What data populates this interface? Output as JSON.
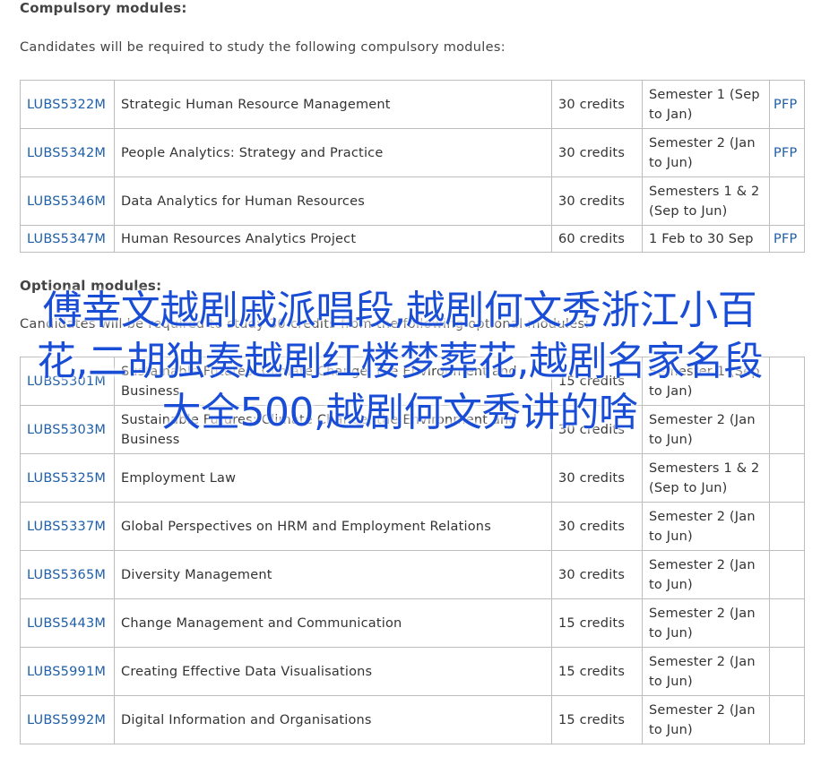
{
  "compulsory": {
    "heading": "Compulsory modules:",
    "intro": "Candidates will be required to study the following compulsory modules:",
    "rows": [
      {
        "code": "LUBS5322M",
        "title": "Strategic Human Resource Management",
        "credits": "30 credits",
        "semester": "Semester 1 (Sep to Jan)",
        "pfp": "PFP"
      },
      {
        "code": "LUBS5342M",
        "title": "People Analytics: Strategy and Practice",
        "credits": "30 credits",
        "semester": "Semester 2 (Jan to Jun)",
        "pfp": "PFP"
      },
      {
        "code": "LUBS5346M",
        "title": "Data Analytics for Human Resources",
        "credits": "30 credits",
        "semester": "Semesters 1 & 2 (Sep to Jun)",
        "pfp": ""
      },
      {
        "code": "LUBS5347M",
        "title": "Human Resources Analytics Project",
        "credits": "60 credits",
        "semester": "1 Feb to 30 Sep",
        "pfp": "PFP"
      }
    ]
  },
  "optional": {
    "heading": "Optional modules:",
    "intro": "Candidates will be required to study 30 credits from the following optional modules:",
    "rows": [
      {
        "code": "LUBS5301M",
        "title": "Sustainable Futures: Climate Change, the Environment and Business",
        "credits": "15 credits",
        "semester": "Semester 1 (Sep to Jan)",
        "pfp": ""
      },
      {
        "code": "LUBS5303M",
        "title": "Sustainable Futures: Climate Change, the Environment and Business",
        "credits": "30 credits",
        "semester": "Semester 2 (Jan to Jun)",
        "pfp": ""
      },
      {
        "code": "LUBS5325M",
        "title": "Employment Law",
        "credits": "30 credits",
        "semester": "Semesters 1 & 2 (Sep to Jun)",
        "pfp": ""
      },
      {
        "code": "LUBS5337M",
        "title": "Global Perspectives on HRM and Employment Relations",
        "credits": "30 credits",
        "semester": "Semester 2 (Jan to Jun)",
        "pfp": ""
      },
      {
        "code": "LUBS5365M",
        "title": "Diversity Management",
        "credits": "30 credits",
        "semester": "Semester 2 (Jan to Jun)",
        "pfp": ""
      },
      {
        "code": "LUBS5443M",
        "title": "Change Management and Communication",
        "credits": "15 credits",
        "semester": "Semester 2 (Jan to Jun)",
        "pfp": ""
      },
      {
        "code": "LUBS5991M",
        "title": "Creating Effective Data Visualisations",
        "credits": "15 credits",
        "semester": "Semester 2 (Jan to Jun)",
        "pfp": ""
      },
      {
        "code": "LUBS5992M",
        "title": "Digital Information and Organisations",
        "credits": "15 credits",
        "semester": "Semester 2 (Jan to Jun)",
        "pfp": ""
      }
    ]
  },
  "overlay_text": "傅幸文越剧戚派唱段,越剧何文秀浙江小百花,二胡独奏越剧红楼梦葬花,越剧名家名段大全500,越剧何文秀讲的啥",
  "colors": {
    "link": "#1f5fa8",
    "overlay": "#1a4dd6",
    "border": "#bdbdbd"
  }
}
